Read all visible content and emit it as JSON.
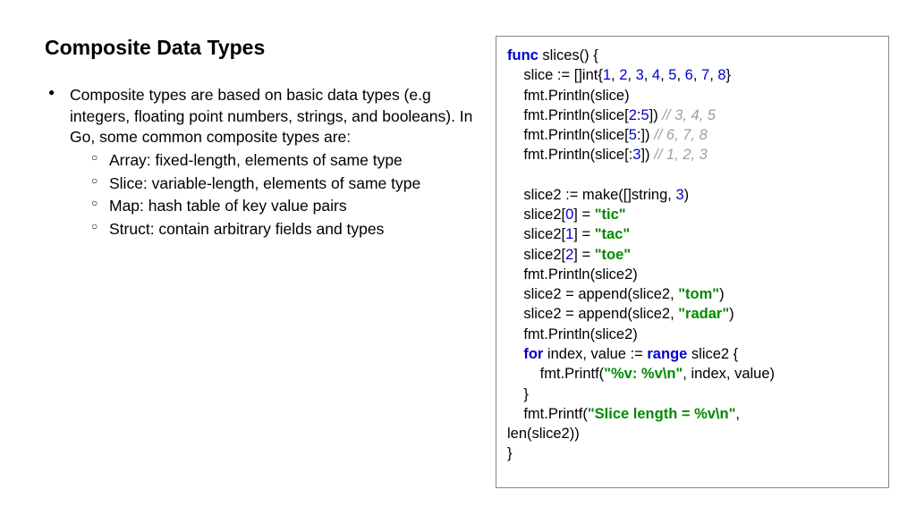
{
  "title": "Composite Data Types",
  "intro": "Composite types are based on basic data types (e.g integers, floating point numbers, strings, and booleans). In Go, some common composite types are:",
  "sub": {
    "a": "Array: fixed-length, elements of same type",
    "b": "Slice: variable-length, elements of same type",
    "c": "Map: hash table of key value pairs",
    "d": "Struct: contain arbitrary fields and types"
  },
  "code": {
    "func": "func",
    "slices": " slices() {",
    "slice_decl_a": "    slice := []int{",
    "n1": "1",
    "n2": "2",
    "n3": "3",
    "n4": "4",
    "n5": "5",
    "n6": "6",
    "n7": "7",
    "n8": "8",
    "brace_close": "}",
    "p1": "    fmt.Println(slice)",
    "p2a": "    fmt.Println(slice[",
    "r1a": "2",
    "colon": ":",
    "r1b": "5",
    "p2b": "]) ",
    "c1": "// 3, 4, 5",
    "p3a": "    fmt.Println(slice[",
    "r2a": "5",
    "p3b": ":]) ",
    "c2": "// 6, 7, 8",
    "p4a": "    fmt.Println(slice[:",
    "r3b": "3",
    "p4b": "]) ",
    "c3": "// 1, 2, 3",
    "make_a": "    slice2 := make([]string, ",
    "make_n": "3",
    "make_b": ")",
    "s0a": "    slice2[",
    "i0": "0",
    "s0b": "] = ",
    "tic": "\"tic\"",
    "i1": "1",
    "tac": "\"tac\"",
    "i2": "2",
    "toe": "\"toe\"",
    "p5": "    fmt.Println(slice2)",
    "ap1a": "    slice2 = append(slice2, ",
    "tom": "\"tom\"",
    "ap1b": ")",
    "radar": "\"radar\"",
    "p6": "    fmt.Println(slice2)",
    "for": "for",
    "for_mid": " index, value := ",
    "range": "range",
    "for_end": " slice2 {",
    "fp_a": "        fmt.Printf(",
    "fmtstr": "\"%v: %v\\n\"",
    "fp_b": ", index, value)",
    "close1": "    }",
    "fp2a": "    fmt.Printf(",
    "slen": "\"Slice length = %v\\n\"",
    "fp2b": ",",
    "last": "len(slice2))",
    "end": "}"
  }
}
